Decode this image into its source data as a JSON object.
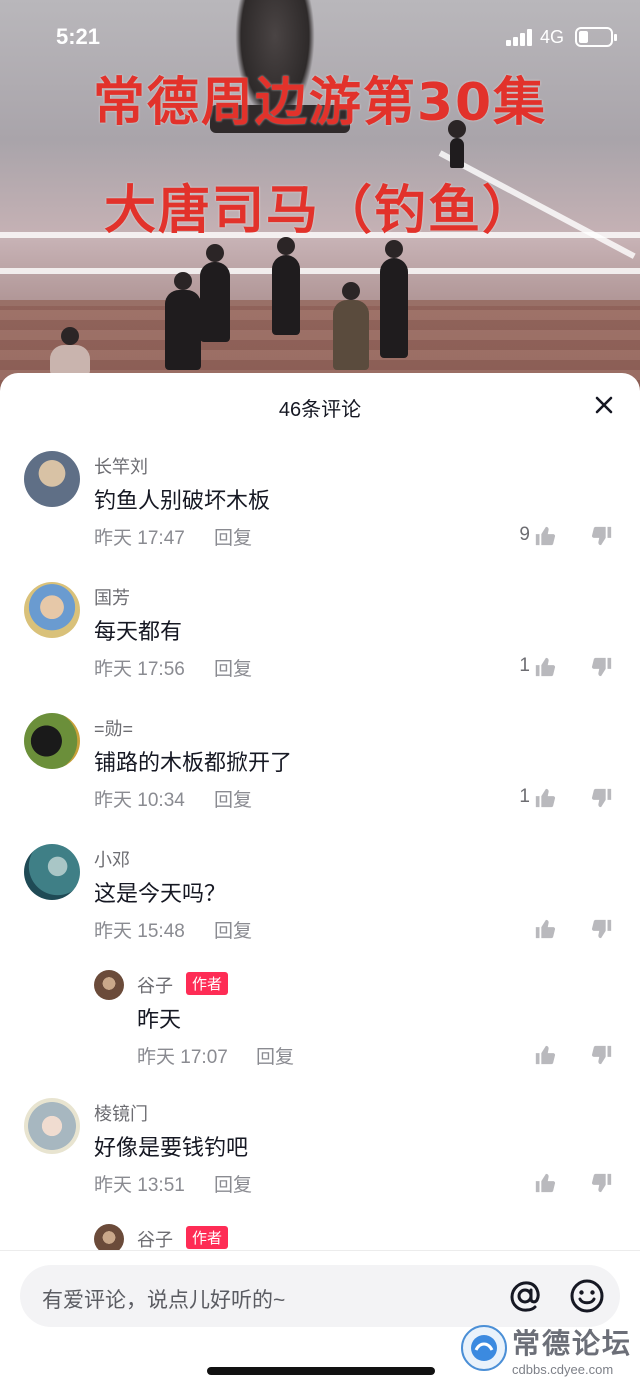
{
  "status_bar": {
    "time": "5:21",
    "network": "4G"
  },
  "video": {
    "title_line1": "常德周边游第30集",
    "title_line2": "大唐司马（钓鱼）"
  },
  "sheet": {
    "title": "46条评论",
    "close_icon": "close-icon"
  },
  "comments": [
    {
      "name": "长竿刘",
      "text": "钓鱼人别破坏木板",
      "time": "昨天 17:47",
      "reply_label": "回复",
      "likes": "9",
      "avatar_color": "#7a8aa0"
    },
    {
      "name": "国芳",
      "text": "每天都有",
      "time": "昨天 17:56",
      "reply_label": "回复",
      "likes": "1",
      "avatar_color": "#c9b68a"
    },
    {
      "name": "=勋=",
      "text": "铺路的木板都掀开了",
      "time": "昨天 10:34",
      "reply_label": "回复",
      "likes": "1",
      "avatar_color": "#3a4a2a"
    },
    {
      "name": "小邓",
      "text": "这是今天吗？",
      "time": "昨天 15:48",
      "reply_label": "回复",
      "likes": "",
      "avatar_color": "#3f7f86"
    },
    {
      "reply": true,
      "name": "谷子",
      "badge": "作者",
      "text": "昨天",
      "time": "昨天 17:07",
      "reply_label": "回复",
      "likes": "",
      "avatar_color": "#6b4b3a"
    },
    {
      "name": "棱镜门",
      "text": "好像是要钱钓吧",
      "time": "昨天 13:51",
      "reply_label": "回复",
      "likes": "",
      "avatar_color": "#a7b7c0"
    },
    {
      "reply": true,
      "name": "谷子",
      "badge": "作者",
      "text": "",
      "time": "",
      "reply_label": "",
      "likes": "",
      "avatar_color": "#6b4b3a"
    }
  ],
  "input": {
    "placeholder": "有爱评论，说点儿好听的~"
  },
  "watermark": {
    "title": "常德论坛",
    "url": "cdbbs.cdyee.com"
  }
}
